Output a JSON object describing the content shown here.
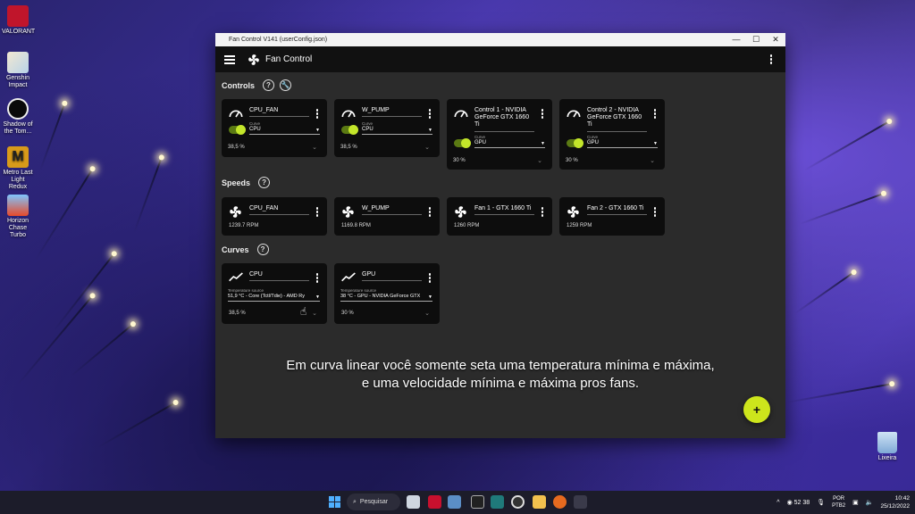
{
  "desktop": {
    "icons": [
      {
        "label": "VALORANT",
        "icon": "valorant-icon",
        "color": "#c0152b"
      },
      {
        "label": "Genshin Impact",
        "icon": "genshin-icon",
        "color": "#e8ddc8"
      },
      {
        "label": "Shadow of the Tom...",
        "icon": "tomb-raider-icon",
        "color": "#0a0a0a"
      },
      {
        "label": "Metro Last Light Redux",
        "icon": "metro-icon",
        "color": "#d89a1a"
      },
      {
        "label": "Horizon Chase Turbo",
        "icon": "horizon-icon",
        "color": "#3b7fd6"
      }
    ],
    "recycle_bin": "Lixeira"
  },
  "window": {
    "title": "Fan Control V141 (userConfig.json)",
    "controls": {
      "minimize": "—",
      "maximize": "☐",
      "close": "✕"
    }
  },
  "app": {
    "title": "Fan Control",
    "accent": "#c3e62a"
  },
  "sections": {
    "controls": "Controls",
    "speeds": "Speeds",
    "curves": "Curves"
  },
  "controls": [
    {
      "name": "CPU_FAN",
      "curve_label": "Curve",
      "curve": "CPU",
      "percent": "38,5 %"
    },
    {
      "name": "W_PUMP",
      "curve_label": "Curve",
      "curve": "CPU",
      "percent": "38,5 %"
    },
    {
      "name": "Control 1 - NVIDIA GeForce GTX 1660 Ti",
      "curve_label": "Curve",
      "curve": "GPU",
      "percent": "30 %"
    },
    {
      "name": "Control 2 - NVIDIA GeForce GTX 1660 Ti",
      "curve_label": "Curve",
      "curve": "GPU",
      "percent": "30 %"
    }
  ],
  "speeds": [
    {
      "name": "CPU_FAN",
      "rpm": "1239.7 RPM"
    },
    {
      "name": "W_PUMP",
      "rpm": "1169.8 RPM"
    },
    {
      "name": "Fan 1 - GTX 1660 Ti",
      "rpm": "1260 RPM"
    },
    {
      "name": "Fan 2 - GTX 1660 Ti",
      "rpm": "1259 RPM"
    }
  ],
  "curves": [
    {
      "name": "CPU",
      "temp_label": "Temperature source",
      "temp_source": "51,9 °C - Core (Tctl/Tdie) - AMD Ry",
      "percent": "38,5 %"
    },
    {
      "name": "GPU",
      "temp_label": "Temperature source",
      "temp_source": "38 °C - GPU - NVIDIA GeForce GTX",
      "percent": "30 %"
    }
  ],
  "subtitle": {
    "line1": "Em curva linear você somente seta uma temperatura mínima e máxima,",
    "line2": "e uma velocidade mínima e máxima pros fans."
  },
  "fab": "+",
  "taskbar": {
    "search": "Pesquisar",
    "weather_temp": "52",
    "weather_val": "38",
    "lang_line1": "POR",
    "lang_line2": "PTB2",
    "time": "10:42",
    "date": "25/12/2022"
  }
}
